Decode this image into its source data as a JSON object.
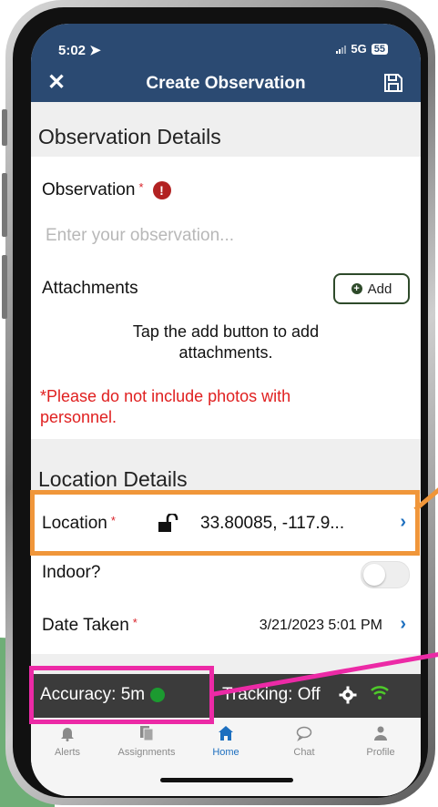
{
  "status_bar": {
    "time": "5:02",
    "network": "5G",
    "battery": "55"
  },
  "header": {
    "title": "Create Observation",
    "close_icon": "close-icon",
    "save_icon": "save-icon"
  },
  "observation_details": {
    "section_title": "Observation Details",
    "observation_label": "Observation",
    "required_mark": "*",
    "error_icon_text": "!",
    "observation_placeholder": "Enter your observation...",
    "attachments_label": "Attachments",
    "add_button_label": "Add",
    "attachments_help": "Tap the add button to add attachments.",
    "photo_warning": "*Please do not include photos with personnel."
  },
  "location_details": {
    "section_title": "Location Details",
    "location_label": "Location",
    "required_mark": "*",
    "coordinates": "33.80085, -117.9...",
    "indoor_label": "Indoor?",
    "indoor_value": false,
    "date_label": "Date Taken",
    "date_value": "3/21/2023 5:01 PM"
  },
  "status_strip": {
    "accuracy_text": "Accuracy:  5m",
    "accuracy_color": "#1c9a30",
    "tracking_text": "Tracking:  Off"
  },
  "bottom_nav": {
    "items": [
      {
        "label": "Alerts",
        "icon": "bell-icon",
        "active": false
      },
      {
        "label": "Assignments",
        "icon": "documents-icon",
        "active": false
      },
      {
        "label": "Home",
        "icon": "home-icon",
        "active": true
      },
      {
        "label": "Chat",
        "icon": "chat-icon",
        "active": false
      },
      {
        "label": "Profile",
        "icon": "person-icon",
        "active": false
      }
    ]
  },
  "colors": {
    "header": "#2b4a72",
    "accent": "#1d6fbf",
    "annotation_orange": "#f0963a",
    "annotation_pink": "#ec2aa6"
  }
}
